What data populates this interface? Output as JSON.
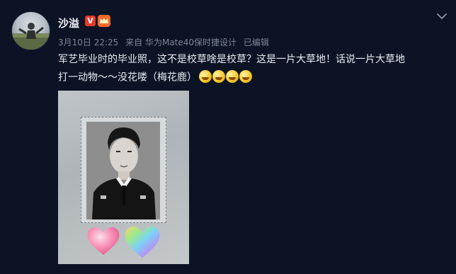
{
  "user": {
    "name": "沙溢",
    "verified_badge": "V",
    "avatar_icon": "avatar",
    "crown_icon": "crown-icon"
  },
  "meta": {
    "date": "3月10日 22:25",
    "source": "来自 华为Mate40保时捷设计",
    "edited": "已编辑"
  },
  "post": {
    "text_line1": "军艺毕业时的毕业照，这不是校草啥是校草？这是一片大草地！话说一片大草地",
    "text_line2": "打一动物～～没花喽（梅花鹿）",
    "emoji_count": 4
  },
  "colors": {
    "background": "#0b1324",
    "badge_red": "#e8392d",
    "meta_gray": "#7c8798"
  }
}
